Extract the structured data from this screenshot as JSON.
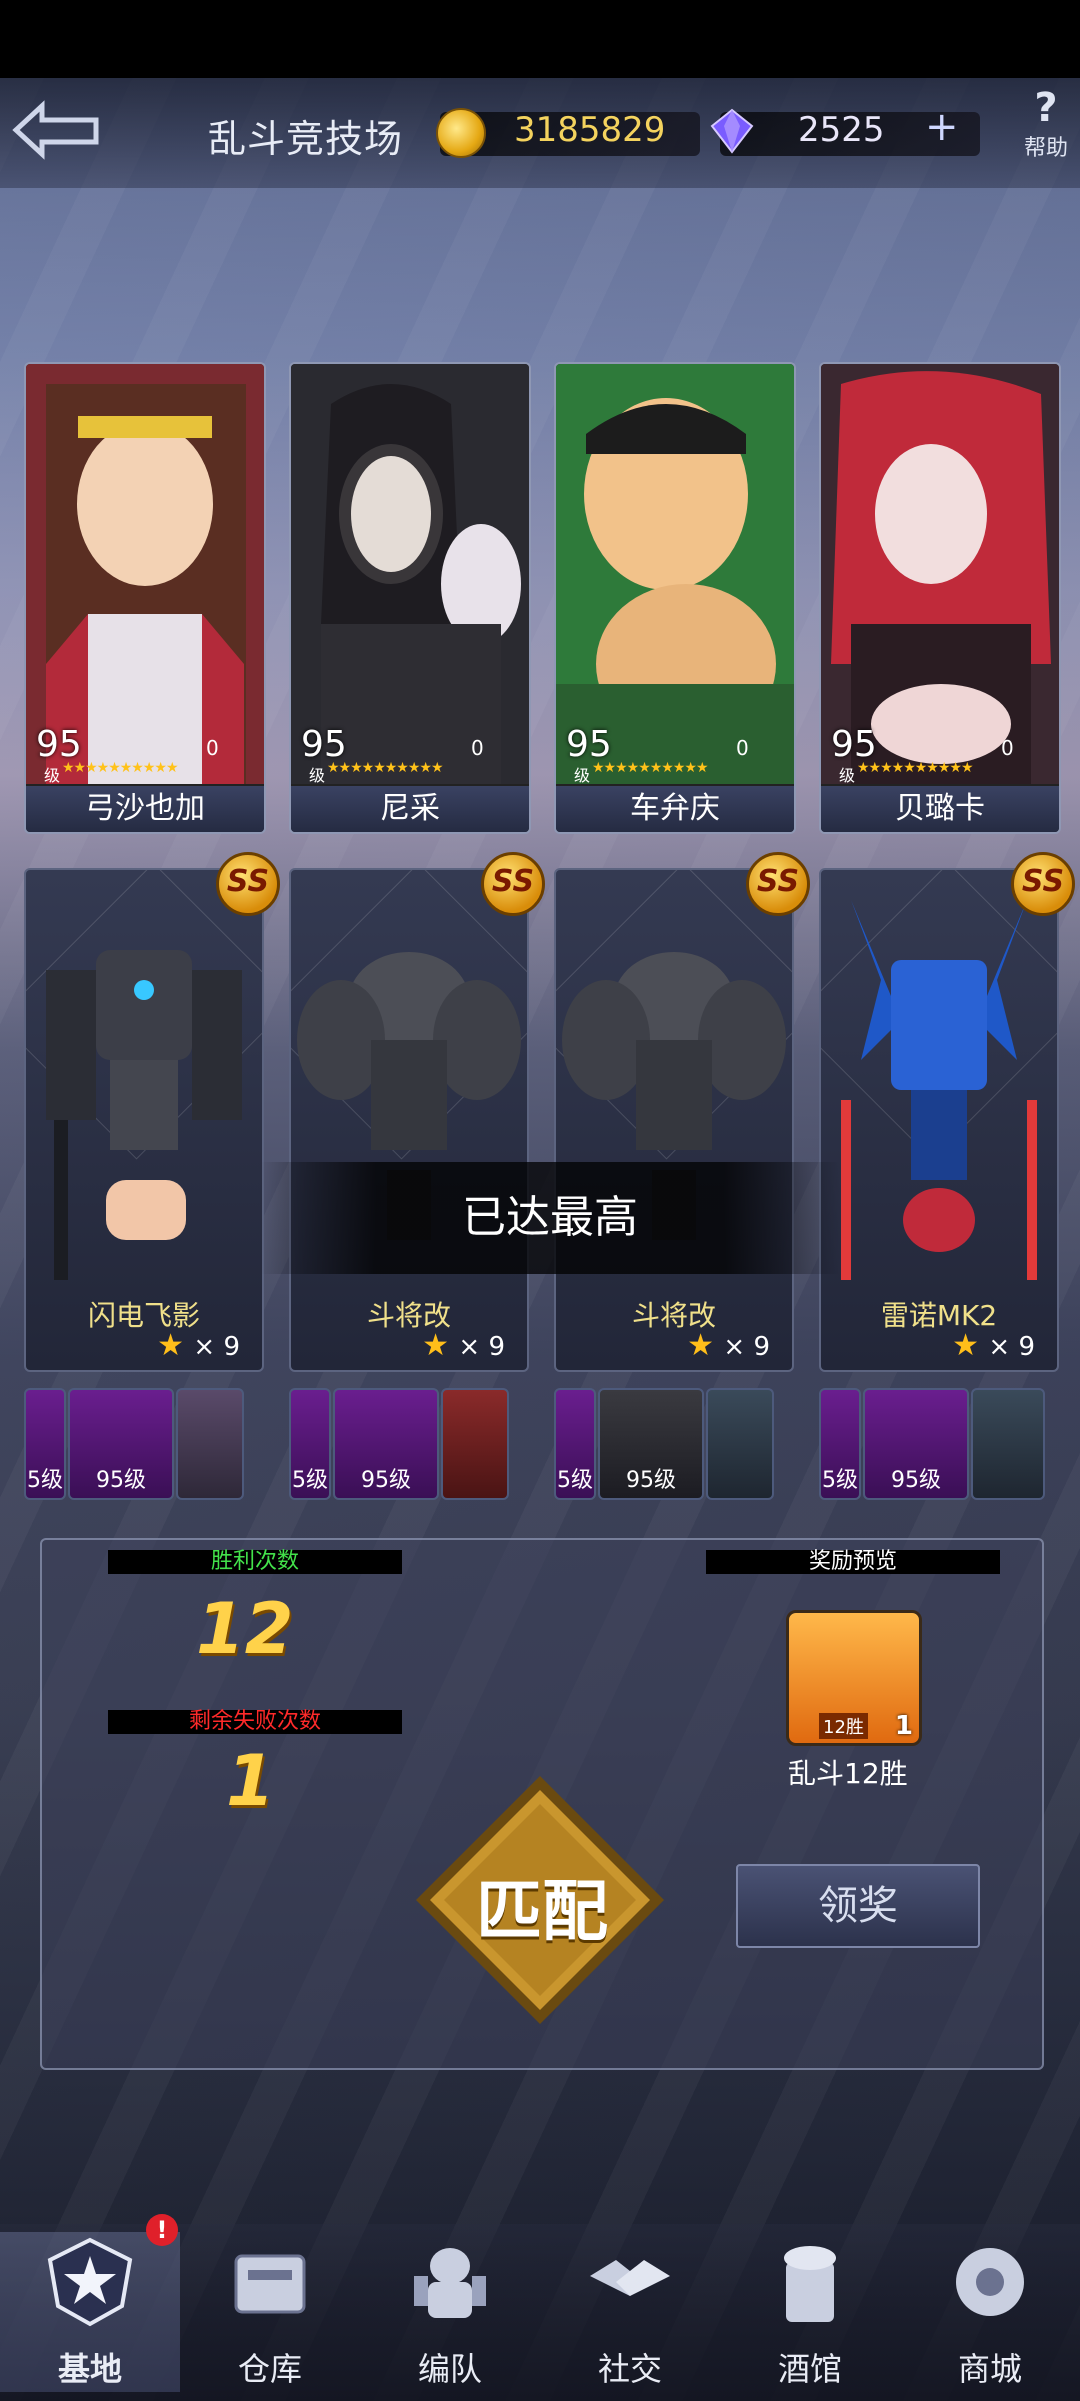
{
  "header": {
    "title": "乱斗竞技场",
    "coins": "3185829",
    "gems": "2525",
    "add_label": "+",
    "help_label": "帮助"
  },
  "pilots": [
    {
      "name": "弓沙也加",
      "level": "95",
      "level_tag": "级",
      "stars": "★★★★★★★★★★",
      "count": "0"
    },
    {
      "name": "尼采",
      "level": "95",
      "level_tag": "级",
      "stars": "★★★★★★★★★★",
      "count": "0"
    },
    {
      "name": "车弁庆",
      "level": "95",
      "level_tag": "级",
      "stars": "★★★★★★★★★★",
      "count": "0"
    },
    {
      "name": "贝璐卡",
      "level": "95",
      "level_tag": "级",
      "stars": "★★★★★★★★★★",
      "count": "0"
    }
  ],
  "mechs": [
    {
      "name": "闪电飞影",
      "rank": "SS",
      "count": "× 9"
    },
    {
      "name": "斗将改",
      "rank": "SS",
      "count": "× 9"
    },
    {
      "name": "斗将改",
      "rank": "SS",
      "count": "× 9"
    },
    {
      "name": "雷诺MK2",
      "rank": "SS",
      "count": "× 9"
    }
  ],
  "equipment_level": "95级",
  "equipment_level_partial": "5级",
  "toast": "已达最高",
  "stats": {
    "wins_label": "胜利次数",
    "wins": "12",
    "losses_left_label": "剩余失败次数",
    "losses_left": "1",
    "reward_label": "奖励预览",
    "reward_name": "乱斗12胜",
    "reward_tag": "12胜",
    "reward_count": "1"
  },
  "buttons": {
    "match": "匹配",
    "claim": "领奖"
  },
  "nav": [
    {
      "label": "基地",
      "icon": "base-emblem-icon"
    },
    {
      "label": "仓库",
      "icon": "warehouse-icon"
    },
    {
      "label": "编队",
      "icon": "formation-icon"
    },
    {
      "label": "社交",
      "icon": "handshake-icon"
    },
    {
      "label": "酒馆",
      "icon": "tavern-icon"
    },
    {
      "label": "商城",
      "icon": "shop-icon"
    }
  ],
  "notify_badge": "!"
}
